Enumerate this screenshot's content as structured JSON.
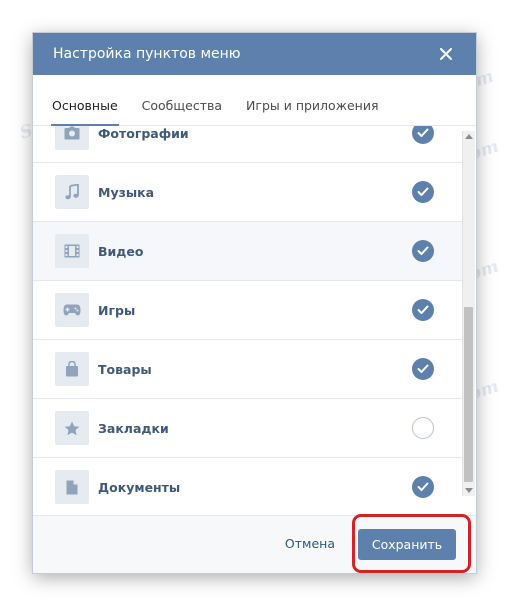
{
  "modal": {
    "title": "Настройка пунктов меню",
    "close_icon": "close-icon"
  },
  "tabs": [
    {
      "label": "Основные",
      "active": true
    },
    {
      "label": "Сообщества",
      "active": false
    },
    {
      "label": "Игры и приложения",
      "active": false
    }
  ],
  "items": [
    {
      "label": "Фотографии",
      "icon": "camera-icon",
      "checked": true
    },
    {
      "label": "Музыка",
      "icon": "music-note-icon",
      "checked": true
    },
    {
      "label": "Видео",
      "icon": "film-icon",
      "checked": true
    },
    {
      "label": "Игры",
      "icon": "gamepad-icon",
      "checked": true
    },
    {
      "label": "Товары",
      "icon": "shopping-bag-icon",
      "checked": true
    },
    {
      "label": "Закладки",
      "icon": "star-icon",
      "checked": false
    },
    {
      "label": "Документы",
      "icon": "document-icon",
      "checked": true
    }
  ],
  "footer": {
    "cancel_label": "Отмена",
    "save_label": "Сохранить"
  },
  "watermark": "Soringpcrepair.com",
  "colors": {
    "header": "#5d81ac",
    "accent": "#5d81ac",
    "highlight": "#d62222"
  }
}
